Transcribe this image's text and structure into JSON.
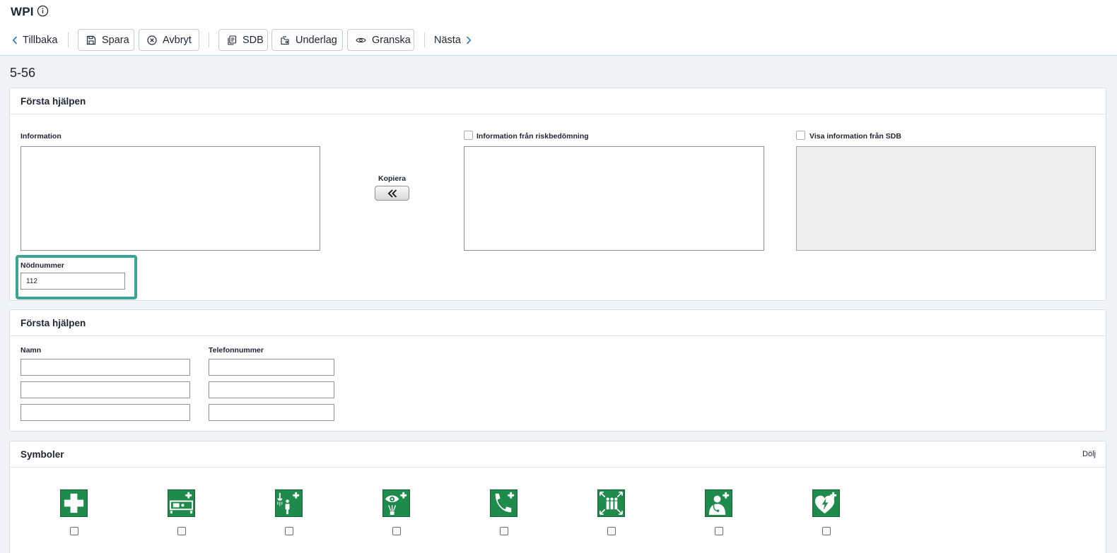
{
  "app": {
    "title": "WPI"
  },
  "toolbar": {
    "back": "Tillbaka",
    "save": "Spara",
    "cancel": "Avbryt",
    "sdb": "SDB",
    "basis": "Underlag",
    "review": "Granska",
    "next": "Nästa"
  },
  "record": {
    "id": "5-56"
  },
  "first_aid": {
    "title": "Första hjälpen",
    "information_label": "Information",
    "copy_label": "Kopiera",
    "risk_info_label": "Information från riskbedömning",
    "sdb_info_label": "Visa information från SDB",
    "emergency_label": "Nödnummer",
    "emergency_value": "112"
  },
  "contacts": {
    "title": "Första hjälpen",
    "name_label": "Namn",
    "phone_label": "Telefonnummer",
    "rows": [
      {
        "name": "",
        "phone": ""
      },
      {
        "name": "",
        "phone": ""
      },
      {
        "name": "",
        "phone": ""
      }
    ]
  },
  "symbols": {
    "title": "Symboler",
    "hide_label": "Dölj",
    "items": [
      {
        "icon": "first-aid-cross-icon",
        "checked": false
      },
      {
        "icon": "stretcher-icon",
        "checked": false
      },
      {
        "icon": "emergency-shower-icon",
        "checked": false
      },
      {
        "icon": "eyewash-station-icon",
        "checked": false
      },
      {
        "icon": "emergency-phone-icon",
        "checked": false
      },
      {
        "icon": "assembly-point-icon",
        "checked": false
      },
      {
        "icon": "doctor-icon",
        "checked": false
      },
      {
        "icon": "defibrillator-icon",
        "checked": false
      }
    ],
    "color": "#1e8a4c"
  }
}
